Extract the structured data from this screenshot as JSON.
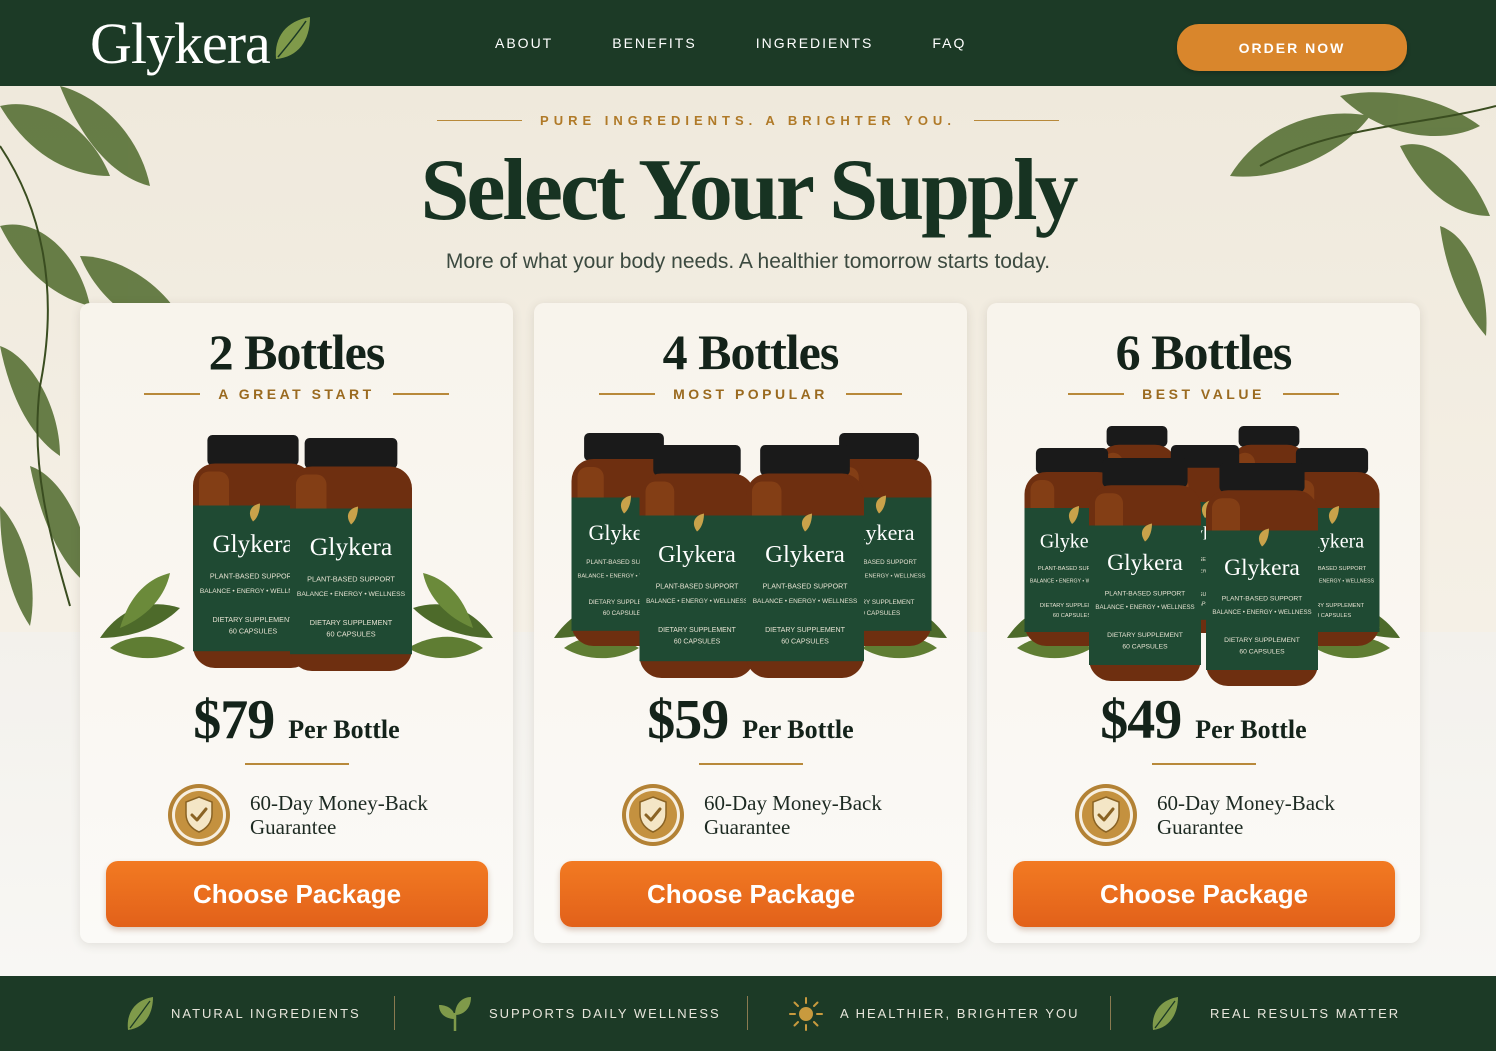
{
  "brand": {
    "name": "Glykera"
  },
  "nav": {
    "links": [
      "ABOUT",
      "BENEFITS",
      "INGREDIENTS",
      "FAQ"
    ],
    "cta": "ORDER NOW"
  },
  "hero": {
    "tagline": "PURE INGREDIENTS. A BRIGHTER YOU.",
    "title": "Select Your Supply",
    "subtitle": "More of what your body needs. A healthier tomorrow starts today."
  },
  "bottle_label": {
    "brand": "Glykera",
    "line1": "PLANT-BASED SUPPORT",
    "line2": "BALANCE • ENERGY • WELLNESS",
    "line3": "DIETARY SUPPLEMENT",
    "line4": "60 CAPSULES"
  },
  "packages": [
    {
      "title": "2 Bottles",
      "subtitle": "A GREAT START",
      "price": "$79",
      "unit": "Per Bottle",
      "guarantee_line1": "60-Day Money-Back",
      "guarantee_line2": "Guarantee",
      "button": "Choose Package",
      "bottle_count": 2
    },
    {
      "title": "4 Bottles",
      "subtitle": "MOST POPULAR",
      "price": "$59",
      "unit": "Per Bottle",
      "guarantee_line1": "60-Day Money-Back",
      "guarantee_line2": "Guarantee",
      "button": "Choose Package",
      "bottle_count": 4
    },
    {
      "title": "6 Bottles",
      "subtitle": "BEST VALUE",
      "price": "$49",
      "unit": "Per Bottle",
      "guarantee_line1": "60-Day Money-Back",
      "guarantee_line2": "Guarantee",
      "button": "Choose Package",
      "bottle_count": 6
    }
  ],
  "footer": {
    "features": [
      {
        "label": "NATURAL INGREDIENTS",
        "icon": "leaf-icon"
      },
      {
        "label": "SUPPORTS DAILY WELLNESS",
        "icon": "sprout-icon"
      },
      {
        "label": "A HEALTHIER, BRIGHTER YOU",
        "icon": "sun-icon"
      },
      {
        "label": "REAL RESULTS MATTER",
        "icon": "leaf-icon"
      }
    ]
  },
  "colors": {
    "nav_bg": "#1c3a26",
    "accent_orange": "#e86c1f",
    "gold": "#b8893a",
    "bottle_label_green": "#1f4a33"
  }
}
